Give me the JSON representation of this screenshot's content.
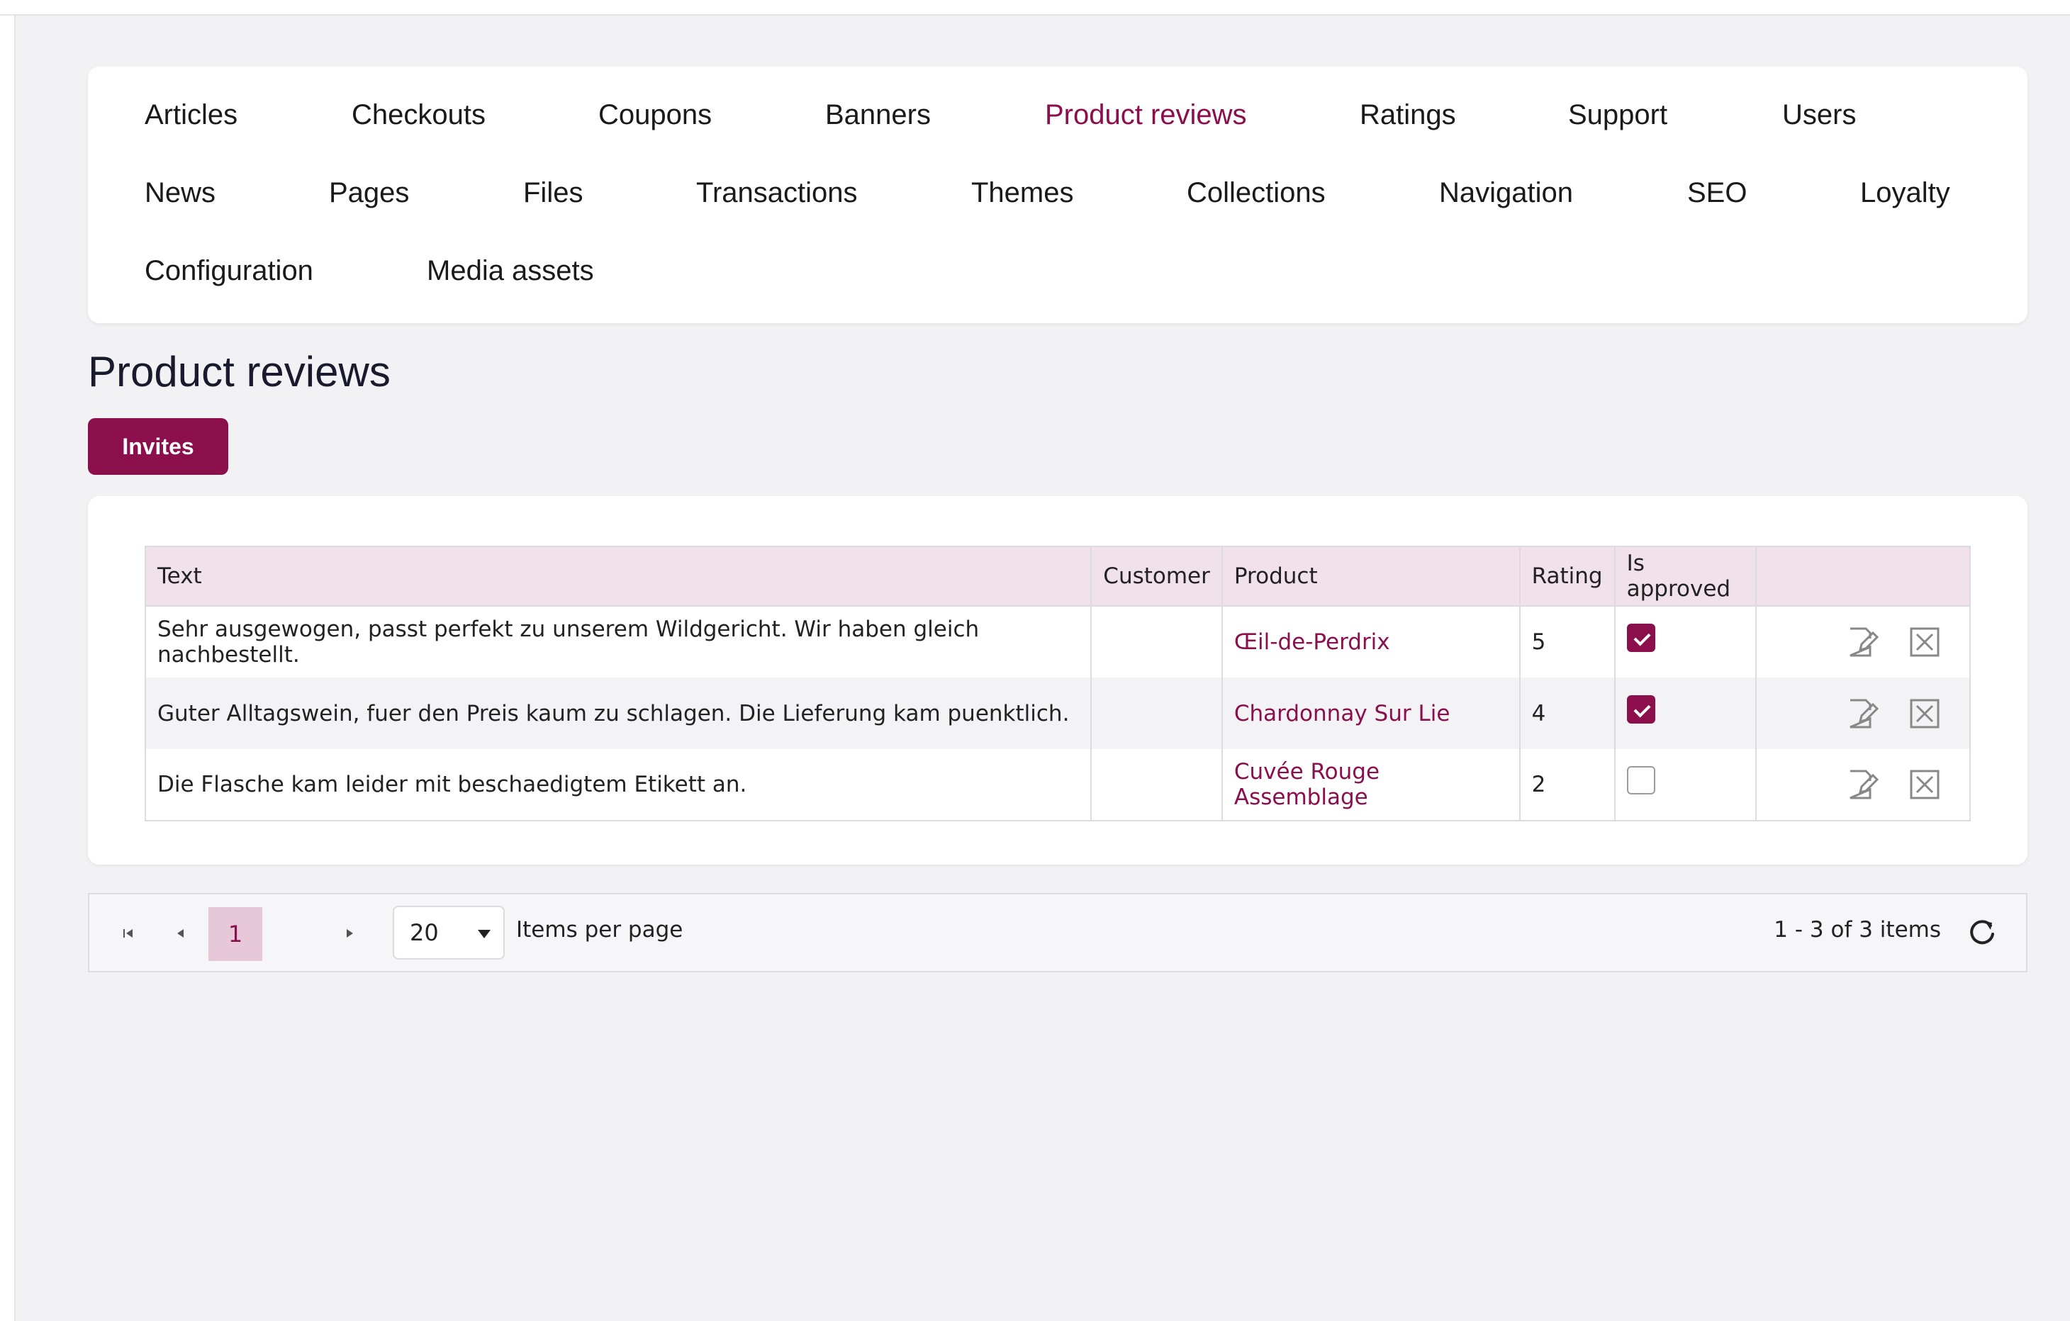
{
  "nav": {
    "items": [
      {
        "label": "Articles"
      },
      {
        "label": "Checkouts"
      },
      {
        "label": "Coupons"
      },
      {
        "label": "Banners"
      },
      {
        "label": "Product reviews"
      },
      {
        "label": "Ratings"
      },
      {
        "label": "Support"
      },
      {
        "label": "Users"
      },
      {
        "label": "News"
      },
      {
        "label": "Pages"
      },
      {
        "label": "Files"
      },
      {
        "label": "Transactions"
      },
      {
        "label": "Themes"
      },
      {
        "label": "Collections"
      },
      {
        "label": "Navigation"
      },
      {
        "label": "SEO"
      },
      {
        "label": "Loyalty"
      },
      {
        "label": "Configuration"
      },
      {
        "label": "Media assets"
      }
    ],
    "active": "Product reviews"
  },
  "page": {
    "title": "Product reviews",
    "invites_label": "Invites"
  },
  "grid": {
    "columns": [
      "Text",
      "Customer",
      "Product",
      "Rating",
      "Is approved",
      ""
    ],
    "rows": [
      {
        "text": "Sehr ausgewogen, passt perfekt zu unserem Wildgericht. Wir haben gleich nachbestellt.",
        "customer": "",
        "product": "Œil-de-Perdrix",
        "rating": "5",
        "approved": true
      },
      {
        "text": "Guter Alltagswein, fuer den Preis kaum zu schlagen. Die Lieferung kam puenktlich.",
        "customer": "",
        "product": "Chardonnay Sur Lie",
        "rating": "4",
        "approved": true
      },
      {
        "text": "Die Flasche kam leider mit beschaedigtem Etikett an.",
        "customer": "",
        "product": "Cuvée Rouge Assemblage",
        "rating": "2",
        "approved": false
      }
    ]
  },
  "pager": {
    "current_page": "1",
    "page_size": "20",
    "items_per_page_label": "Items per page",
    "info": "1 - 3 of 3 items"
  },
  "colors": {
    "accent": "#8b0f4d",
    "header_bg": "#f0e1ea",
    "page_bg": "#f2f2f4"
  }
}
